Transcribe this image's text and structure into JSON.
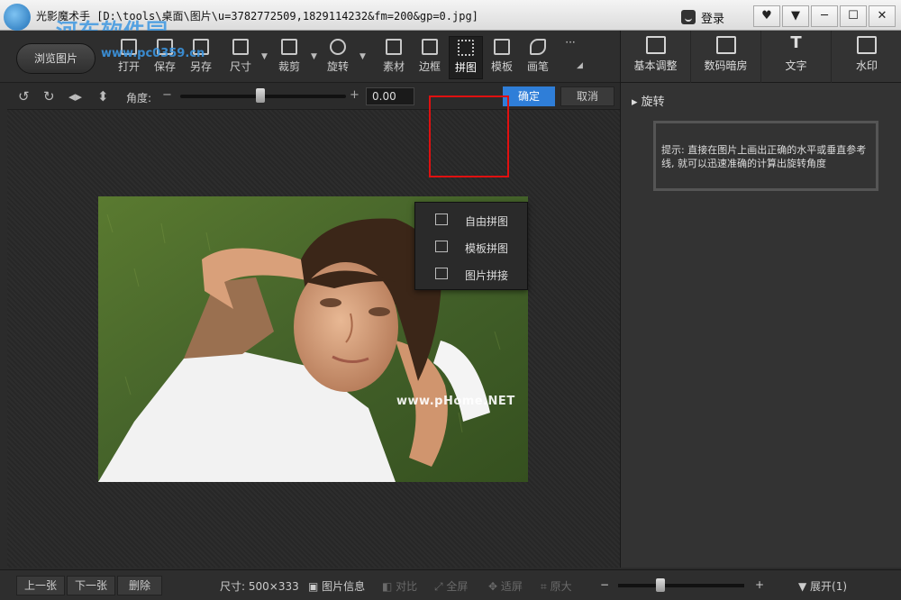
{
  "window": {
    "title": "光影魔术手 [D:\\tools\\桌面\\图片\\u=3782772509,1829114232&fm=200&gp=0.jpg]",
    "login_label": "登录",
    "controls": [
      "♥",
      "▼",
      "─",
      "☐",
      "✕"
    ]
  },
  "watermark": {
    "site_name": "河东软件园",
    "site_url": "www.pc0359.cn"
  },
  "toolbar": {
    "browse_label": "浏览图片",
    "tools": [
      "打开",
      "保存",
      "另存",
      "尺寸",
      "裁剪",
      "旋转",
      "素材",
      "边框",
      "拼图",
      "模板",
      "画笔",
      "···"
    ],
    "active_tool": "拼图"
  },
  "right_tools": [
    "基本调整",
    "数码暗房",
    "文字",
    "水印"
  ],
  "rotate": {
    "angle_label": "角度:",
    "angle_value": "0.00",
    "confirm_label": "确定",
    "cancel_label": "取消"
  },
  "dropdown": {
    "items": [
      "自由拼图",
      "模板拼图",
      "图片拼接"
    ]
  },
  "photo": {
    "watermark_text": "www.pHome.NET"
  },
  "right_panel": {
    "title": "旋转",
    "tip": "提示: 直接在图片上画出正确的水平或垂直参考线, 就可以迅速准确的计算出旋转角度"
  },
  "statusbar": {
    "prev_label": "上一张",
    "next_label": "下一张",
    "delete_label": "删除",
    "size_text": "尺寸: 500×333",
    "info_label": "图片信息",
    "compare_label": "对比",
    "fullscreen_label": "全屏",
    "fit_label": "适屏",
    "original_label": "原大",
    "expand_label": "展开(1)"
  }
}
